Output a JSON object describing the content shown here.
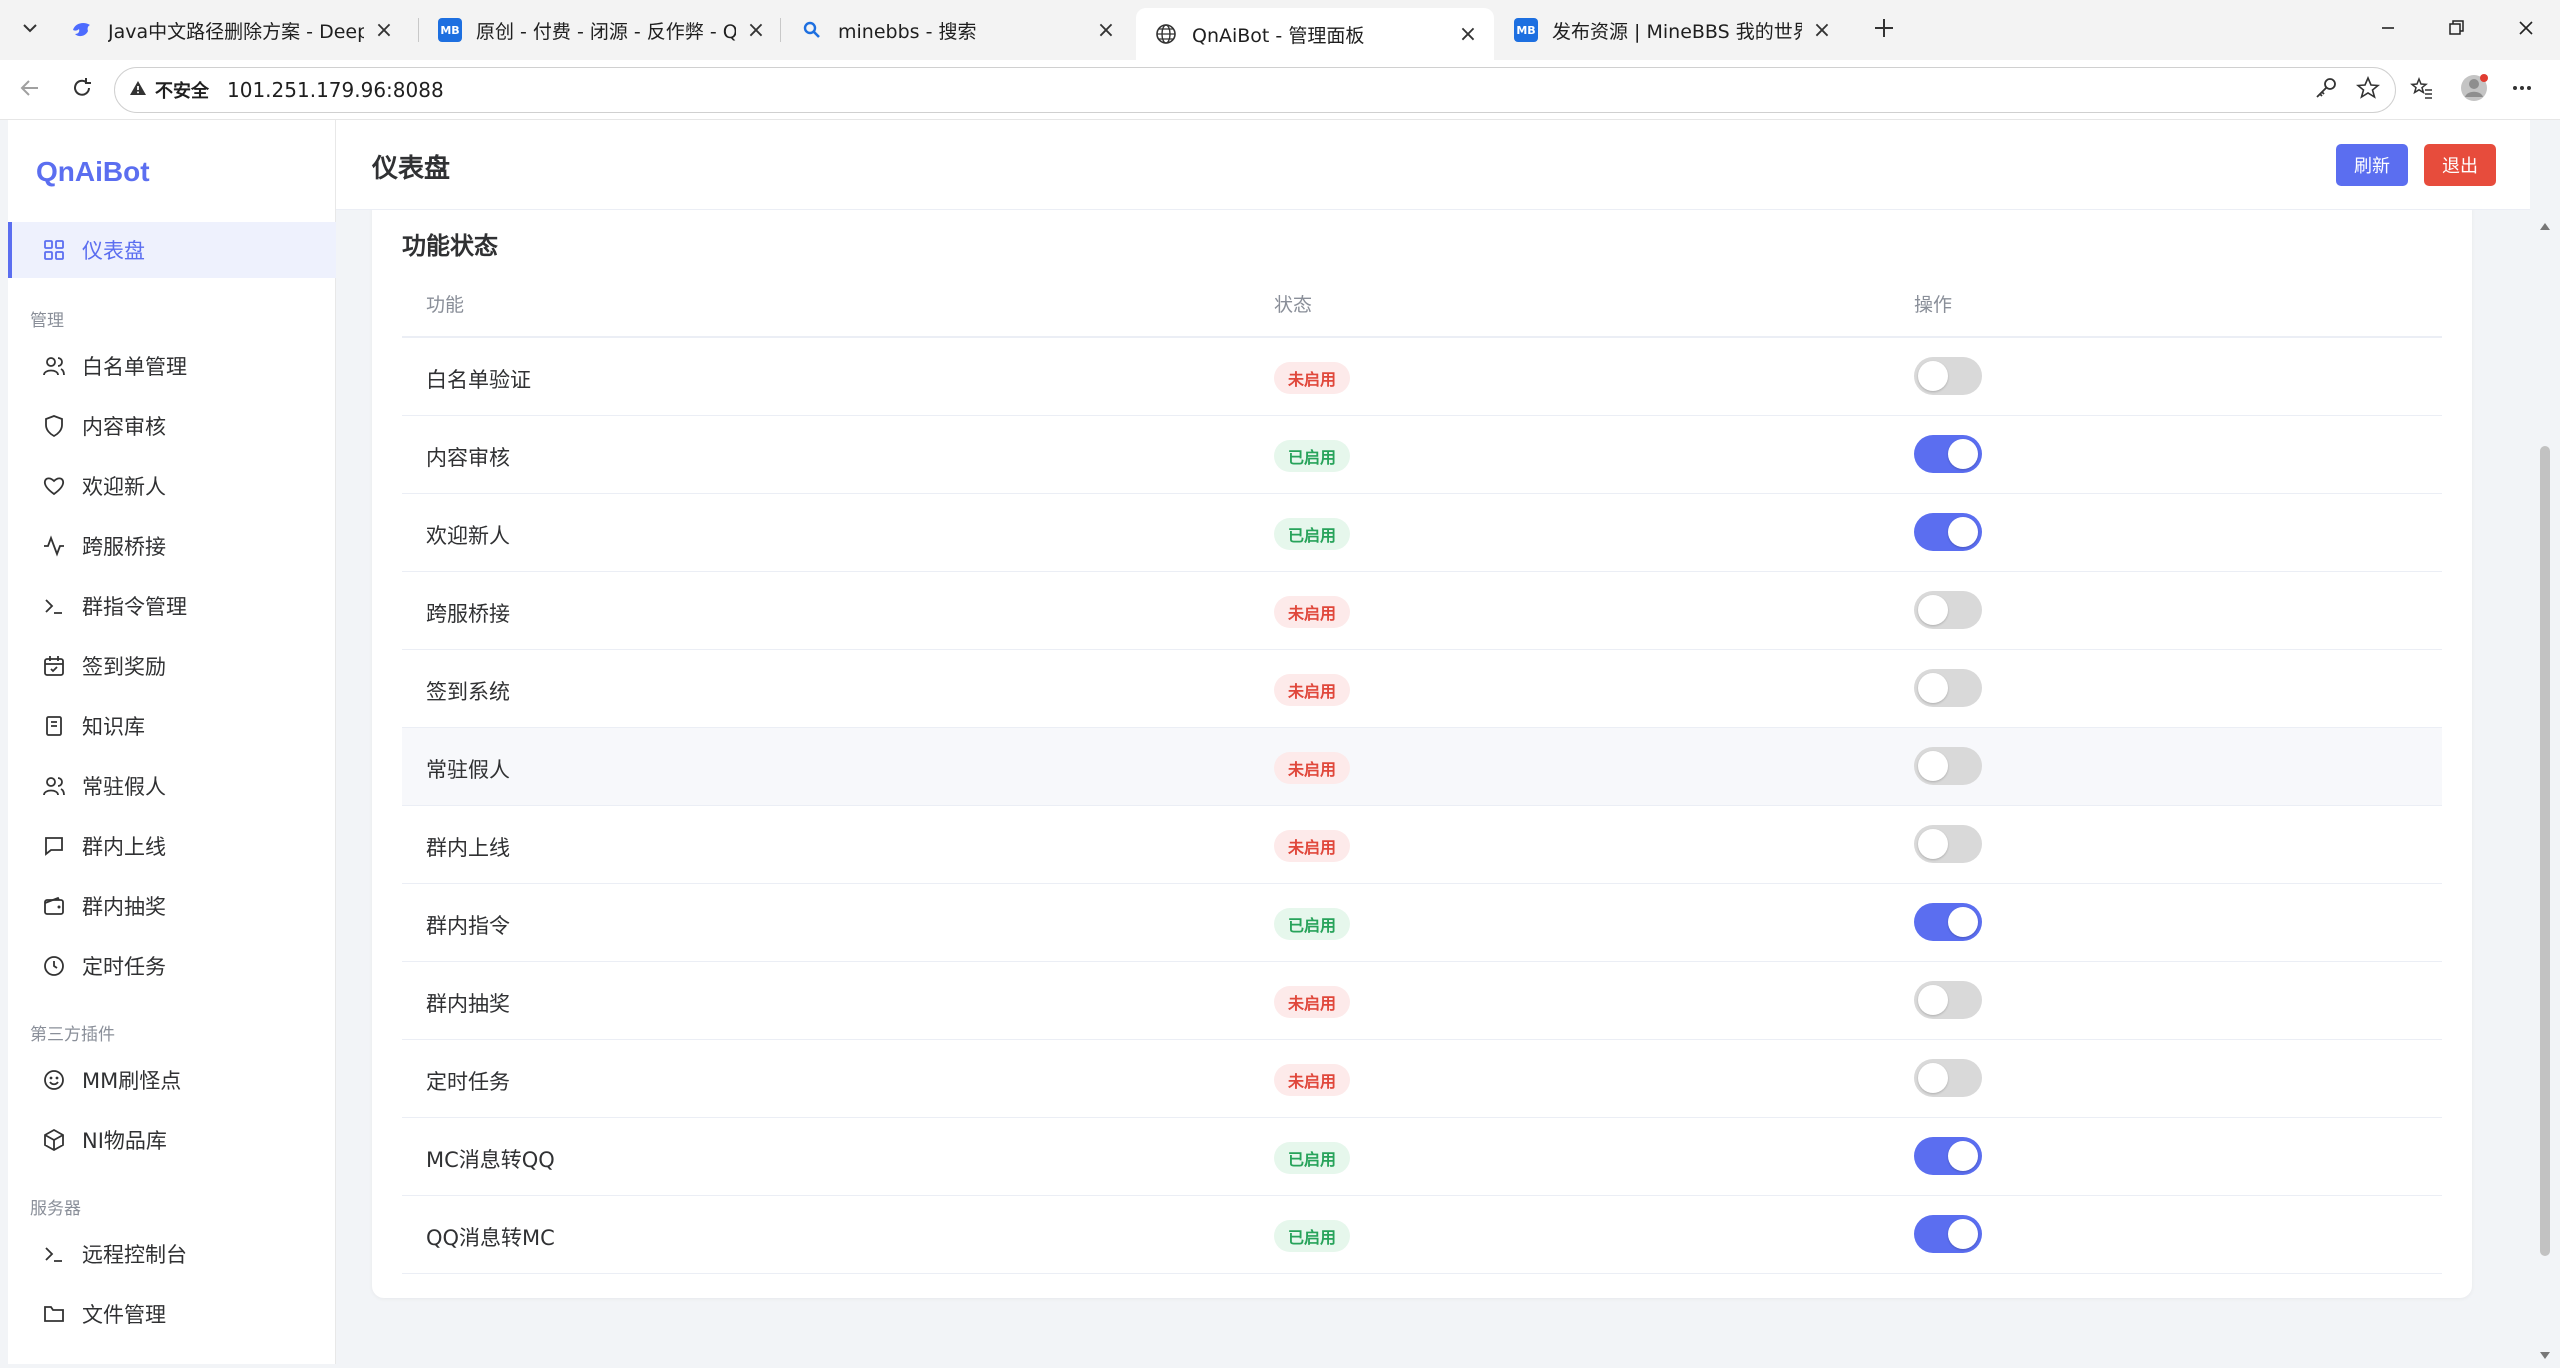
{
  "browser": {
    "tabs": [
      {
        "title": "Java中文路径删除方案 - DeepSeek",
        "icon": "deepseek-icon"
      },
      {
        "title": "原创 - 付费 - 闭源 - 反作弊 - QnAi",
        "icon": "minebbs-icon",
        "fav_label": "MB"
      },
      {
        "title": "minebbs - 搜索",
        "icon": "search-icon"
      },
      {
        "title": "QnAiBot - 管理面板",
        "icon": "globe-icon"
      },
      {
        "title": "发布资源 | MineBBS 我的世界中文",
        "icon": "minebbs-icon",
        "fav_label": "MB"
      }
    ],
    "security_label": "不安全",
    "url": "101.251.179.96:8088"
  },
  "sidebar": {
    "logo": "QnAiBot",
    "dashboard": "仪表盘",
    "section_manage": "管理",
    "section_plugins": "第三方插件",
    "section_server": "服务器",
    "items_manage": [
      {
        "label": "白名单管理",
        "icon": "users-icon"
      },
      {
        "label": "内容审核",
        "icon": "shield-icon"
      },
      {
        "label": "欢迎新人",
        "icon": "heart-icon"
      },
      {
        "label": "跨服桥接",
        "icon": "activity-icon"
      },
      {
        "label": "群指令管理",
        "icon": "terminal-icon"
      },
      {
        "label": "签到奖励",
        "icon": "calendar-check-icon"
      },
      {
        "label": "知识库",
        "icon": "book-icon"
      },
      {
        "label": "常驻假人",
        "icon": "users-icon"
      },
      {
        "label": "群内上线",
        "icon": "message-icon"
      },
      {
        "label": "群内抽奖",
        "icon": "wallet-icon"
      },
      {
        "label": "定时任务",
        "icon": "clock-icon"
      }
    ],
    "items_plugins": [
      {
        "label": "MM刷怪点",
        "icon": "smile-icon"
      },
      {
        "label": "NI物品库",
        "icon": "box-icon"
      }
    ],
    "items_server": [
      {
        "label": "远程控制台",
        "icon": "terminal-icon"
      },
      {
        "label": "文件管理",
        "icon": "folder-icon"
      }
    ]
  },
  "header": {
    "title": "仪表盘",
    "refresh_label": "刷新",
    "logout_label": "退出"
  },
  "features": {
    "title": "功能状态",
    "columns": [
      "功能",
      "状态",
      "操作"
    ],
    "status_on": "已启用",
    "status_off": "未启用",
    "rows": [
      {
        "name": "白名单验证",
        "enabled": false
      },
      {
        "name": "内容审核",
        "enabled": true
      },
      {
        "name": "欢迎新人",
        "enabled": true
      },
      {
        "name": "跨服桥接",
        "enabled": false
      },
      {
        "name": "签到系统",
        "enabled": false
      },
      {
        "name": "常驻假人",
        "enabled": false
      },
      {
        "name": "群内上线",
        "enabled": false
      },
      {
        "name": "群内指令",
        "enabled": true
      },
      {
        "name": "群内抽奖",
        "enabled": false
      },
      {
        "name": "定时任务",
        "enabled": false
      },
      {
        "name": "MC消息转QQ",
        "enabled": true
      },
      {
        "name": "QQ消息转MC",
        "enabled": true
      }
    ]
  },
  "colors": {
    "accent": "#5b6ef0",
    "danger": "#e74c3c",
    "enabled_text": "#27a35a",
    "disabled_text": "#e0473b"
  }
}
